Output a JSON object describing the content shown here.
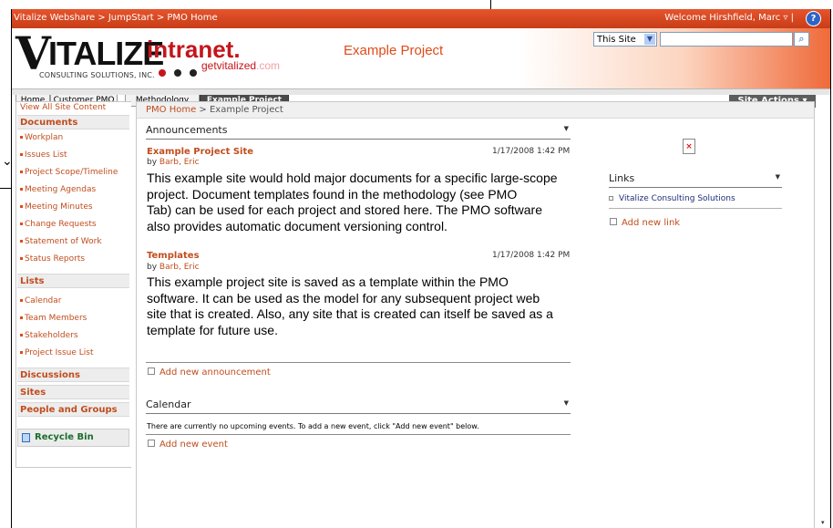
{
  "topbar": {
    "breadcrumb": "Vitalize Webshare > JumpStart > PMO Home",
    "welcome": "Welcome Hirshfield, Marc ▿ |",
    "help_icon": "?"
  },
  "logo": {
    "letter_v": "V",
    "word": "ITALIZE",
    "intranet": "intranet.",
    "site_prefix": "getvitalized",
    "site_suffix": ".com",
    "sub": "CONSULTING SOLUTIONS, INC.",
    "dot_colors": [
      "#c4151b",
      "#222222",
      "#222222"
    ]
  },
  "header": {
    "site_title": "Example Project",
    "search_scope": "This Site",
    "search_value": "",
    "search_icon": "search-icon"
  },
  "tabs": [
    "Home",
    "Customer PMO",
    "Methodology",
    "Example Project"
  ],
  "site_actions": "Site Actions ▾",
  "leftnav": {
    "view_all": "View All Site Content",
    "documents_head": "Documents",
    "documents": [
      "Workplan",
      "Issues List",
      "Project Scope/Timeline",
      "Meeting Agendas",
      "Meeting Minutes",
      "Change Requests",
      "Statement of Work",
      "Status Reports"
    ],
    "lists_head": "Lists",
    "lists": [
      "Calendar",
      "Team Members",
      "Stakeholders",
      "Project Issue List"
    ],
    "discussions": "Discussions",
    "sites": "Sites",
    "people": "People and Groups",
    "recycle": "Recycle Bin"
  },
  "content": {
    "crumb_link": "PMO Home",
    "crumb_rest": " > Example Project",
    "announcements": {
      "title": "Announcements",
      "items": [
        {
          "title": "Example Project Site",
          "date": "1/17/2008 1:42 PM",
          "by": "by ",
          "author": "Barb, Eric",
          "lines": [
            "This example site would hold major documents for a specific large-scope",
            "project.  Document templates found in the methodology (see PMO",
            "Tab) can be used for each project and stored here.  The PMO software",
            "also provides automatic document versioning control."
          ]
        },
        {
          "title": "Templates",
          "date": "1/17/2008 1:42 PM",
          "by": "by ",
          "author": "Barb, Eric",
          "lines": [
            "This example project site is saved as a template within the PMO",
            "software.   It can be used as the model for any subsequent project web",
            "site that is created.  Also, any site that is created can itself be saved as a",
            "template for future use."
          ]
        }
      ],
      "add": "Add new announcement"
    },
    "calendar": {
      "title": "Calendar",
      "empty": "There are currently no upcoming events. To add a new event, click \"Add new event\" below.",
      "add": "Add new event"
    },
    "links": {
      "title": "Links",
      "items": [
        "Vitalize Consulting Solutions"
      ],
      "add": "Add new link"
    },
    "broken_image": "×"
  }
}
